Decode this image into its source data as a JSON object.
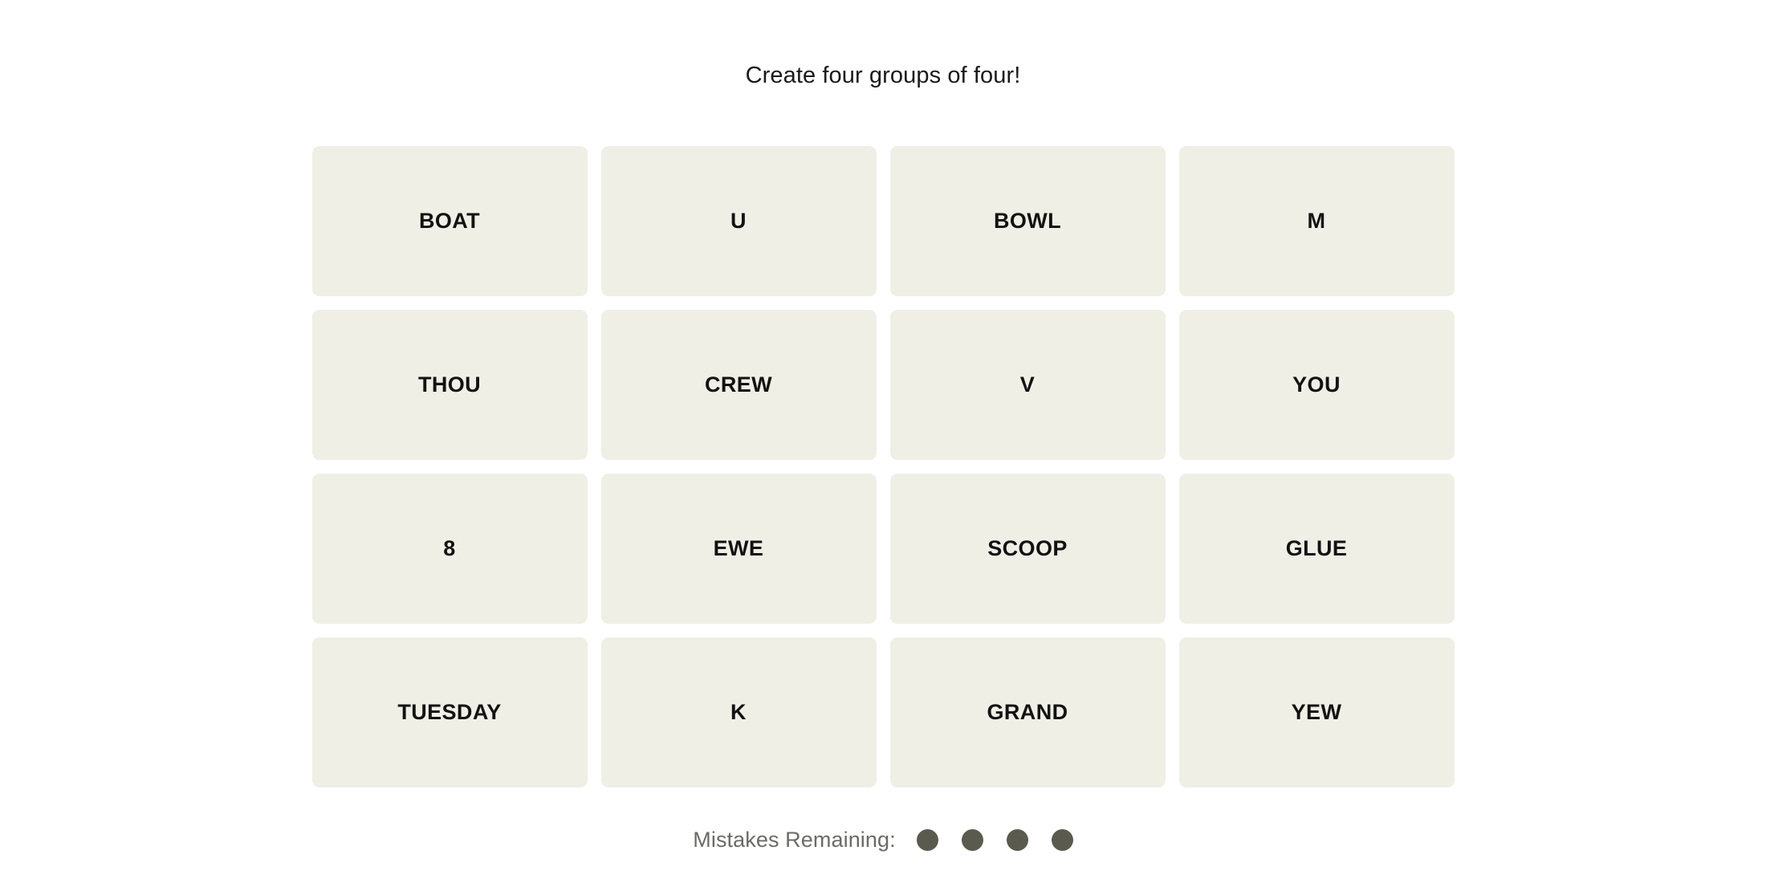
{
  "page": {
    "background_color": "#ffffff"
  },
  "header": {
    "title": "Create four groups of four!"
  },
  "board": {
    "columns": 4,
    "rows": 4,
    "tile_background_color": "#efefe6",
    "tile_text_color": "#121212",
    "tiles": [
      {
        "label": "BOAT"
      },
      {
        "label": "U"
      },
      {
        "label": "BOWL"
      },
      {
        "label": "M"
      },
      {
        "label": "THOU"
      },
      {
        "label": "CREW"
      },
      {
        "label": "V"
      },
      {
        "label": "YOU"
      },
      {
        "label": "8"
      },
      {
        "label": "EWE"
      },
      {
        "label": "SCOOP"
      },
      {
        "label": "GLUE"
      },
      {
        "label": "TUESDAY"
      },
      {
        "label": "K"
      },
      {
        "label": "GRAND"
      },
      {
        "label": "YEW"
      }
    ]
  },
  "footer": {
    "mistakes_label": "Mistakes Remaining:",
    "mistakes_remaining": 4,
    "dot_color": "#5a5a4e",
    "label_color": "#6b6b66"
  }
}
